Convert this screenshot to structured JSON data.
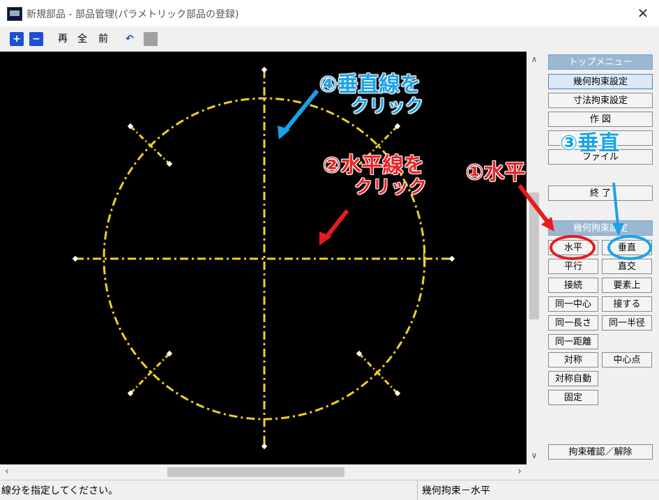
{
  "window": {
    "title": "新規部品 - 部品管理(パラメトリック部品の登録)",
    "close": "✕"
  },
  "toolbar": {
    "zoom_in": "+",
    "zoom_out": "−",
    "redraw": "再",
    "all": "全",
    "previous": "前",
    "undo": "↶"
  },
  "annotations": {
    "step4_line1": "④垂直線を",
    "step4_line2": "クリック",
    "step2_line1": "②水平線を",
    "step2_line2": "クリック",
    "step1": "①水平",
    "step3": "③垂直"
  },
  "panel": {
    "top_menu": "トップメニュー",
    "menu": [
      "幾何拘束設定",
      "寸法拘束設定",
      "作 図",
      "",
      "ファイル"
    ],
    "exit": "終 了",
    "section_title": "幾何拘束設定",
    "grid": [
      [
        "水平",
        "垂直"
      ],
      [
        "平行",
        "直交"
      ],
      [
        "接続",
        "要素上"
      ],
      [
        "同一中心",
        "接する"
      ],
      [
        "同一長さ",
        "同一半径"
      ],
      [
        "同一距離",
        ""
      ],
      [
        "対称",
        "中心点"
      ],
      [
        "対称自動",
        ""
      ],
      [
        "固定",
        ""
      ]
    ],
    "confirm": "拘束確認／解除"
  },
  "status": {
    "message": "線分を指定してください。",
    "mode": "幾何拘束－水平"
  },
  "colors": {
    "construction": "#f2d21b",
    "canvas": "#000000",
    "annotation_blue": "#1aa3e8",
    "annotation_red": "#ee2222"
  }
}
